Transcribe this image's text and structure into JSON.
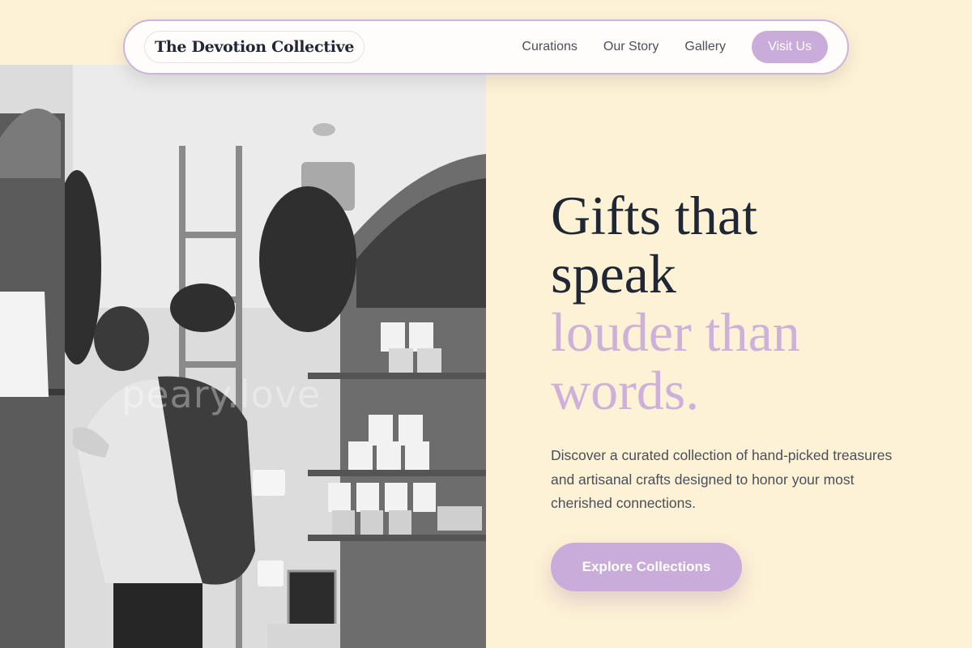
{
  "nav": {
    "brand": "The Devotion Collective",
    "links": [
      "Curations",
      "Our Story",
      "Gallery"
    ],
    "cta": "Visit Us"
  },
  "hero": {
    "title_line1": "Gifts that",
    "title_line2": "speak",
    "title_accent1": "louder than",
    "title_accent2": "words.",
    "description": "Discover a curated collection of hand-picked treasures and artisanal crafts designed to honor your most cherished connections.",
    "cta": "Explore Collections",
    "image_watermark": "peary.love"
  },
  "colors": {
    "background": "#fdf1d6",
    "accent": "#c9acd9",
    "heading": "#1f2634",
    "body_text": "#4a4f5a"
  }
}
